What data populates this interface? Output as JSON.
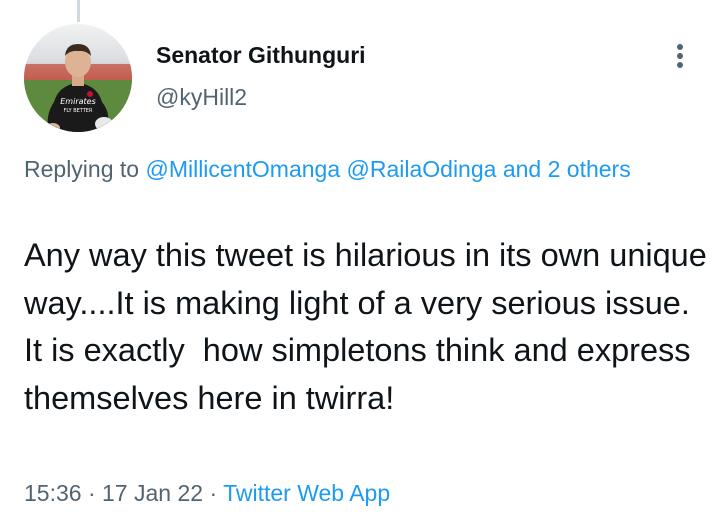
{
  "tweet": {
    "author": {
      "name": "Senator Githunguri",
      "handle": "@kyHill2",
      "avatar_icon": "profile-photo",
      "jersey_text": "Emirates FLY BETTER"
    },
    "more_icon": "more-vertical-icon",
    "replying": {
      "prefix": "Replying to",
      "mention_1": "@MillicentOmanga",
      "mention_2": "@RailaOdinga",
      "others": "and 2 others"
    },
    "text": "Any way this tweet is hilarious in its own unique way....It is making light of a very serious issue. It is exactly  how simpletons think and express themselves here in twirra!",
    "time": "15:36",
    "separator": "·",
    "date": "17 Jan 22",
    "source": "Twitter Web App"
  },
  "colors": {
    "text": "#0f1419",
    "secondary": "#536471",
    "link": "#1d9bf0",
    "thread_line": "#cfd9de",
    "background": "#ffffff"
  }
}
